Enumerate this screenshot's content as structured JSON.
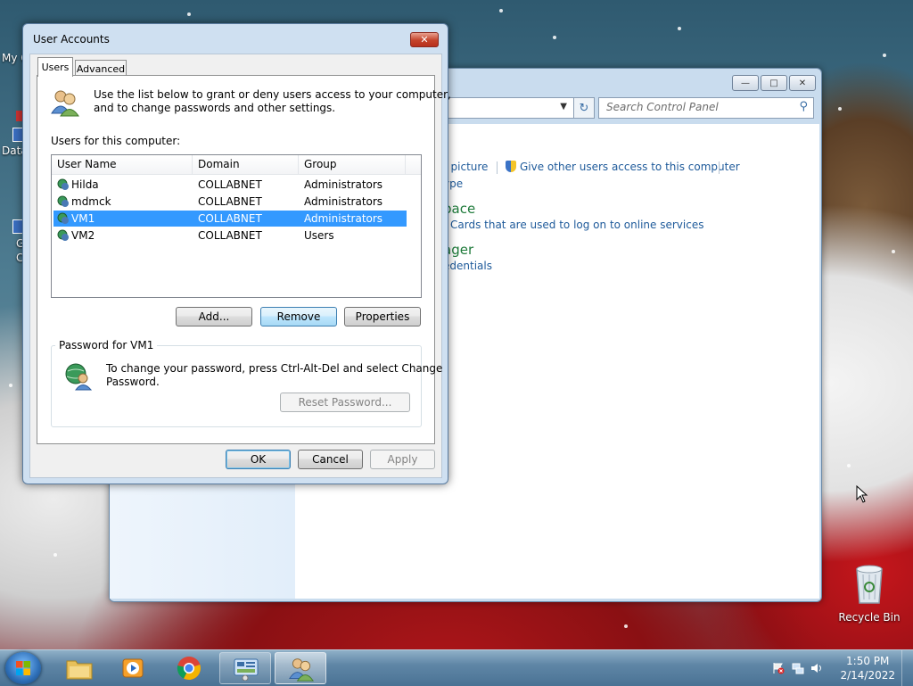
{
  "desktop": {
    "icons": [
      {
        "label": "Recycle Bin"
      }
    ],
    "partial_labels": [
      "My C",
      "Data",
      "G",
      "C"
    ]
  },
  "control_panel": {
    "search_placeholder": "Search Control Panel",
    "links": {
      "change_picture": "t picture",
      "give_access": "Give other users access to this computer",
      "account_type": "ype",
      "credential_space": "pace",
      "cards": "Cards that are used to log on to online services",
      "manager": "ager",
      "credentials": "edentials"
    }
  },
  "dialog": {
    "title": "User Accounts",
    "tabs": [
      "Users",
      "Advanced"
    ],
    "intro": "Use the list below to grant or deny users access to your computer,",
    "intro2": "and to change passwords and other settings.",
    "list_label": "Users for this computer:",
    "columns": [
      "User Name",
      "Domain",
      "Group"
    ],
    "users": [
      {
        "name": "Hilda",
        "domain": "COLLABNET",
        "group": "Administrators"
      },
      {
        "name": "mdmck",
        "domain": "COLLABNET",
        "group": "Administrators"
      },
      {
        "name": "VM1",
        "domain": "COLLABNET",
        "group": "Administrators",
        "selected": true
      },
      {
        "name": "VM2",
        "domain": "COLLABNET",
        "group": "Users"
      }
    ],
    "buttons": {
      "add": "Add...",
      "remove": "Remove",
      "properties": "Properties"
    },
    "password_group": "Password for VM1",
    "password_text1": "To change your password, press Ctrl-Alt-Del and select Change",
    "password_text2": "Password.",
    "reset_password": "Reset Password...",
    "ok": "OK",
    "cancel": "Cancel",
    "apply": "Apply"
  },
  "taskbar": {
    "time": "1:50 PM",
    "date": "2/14/2022"
  },
  "colors": {
    "selection": "#3399ff",
    "link": "#1e5a9a",
    "heading_green": "#1e7a3a"
  }
}
